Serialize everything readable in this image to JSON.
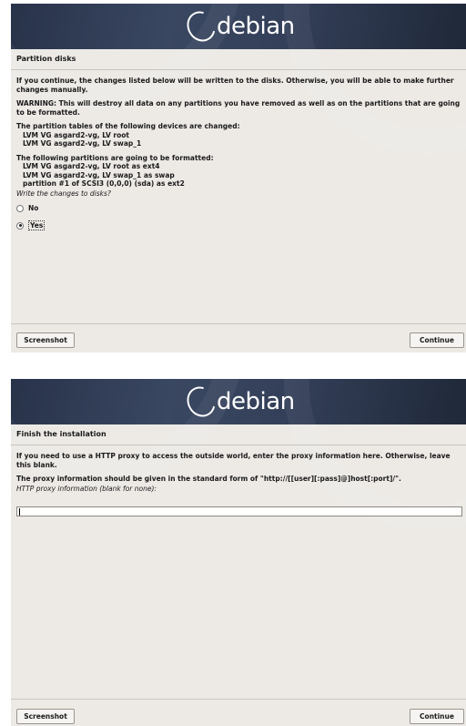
{
  "brand": {
    "logo_text": "debian"
  },
  "screen1": {
    "title": "Partition disks",
    "paragraphs": [
      "If you continue, the changes listed below will be written to the disks. Otherwise, you will be able to make further changes manually.",
      "WARNING: This will destroy all data on any partitions you have removed as well as on the partitions that are going to be formatted."
    ],
    "partition_tables_heading": "The partition tables of the following devices are changed:",
    "partition_tables": [
      "LVM VG asgard2-vg, LV root",
      "LVM VG asgard2-vg, LV swap_1"
    ],
    "formatted_heading": "The following partitions are going to be formatted:",
    "formatted": [
      "LVM VG asgard2-vg, LV root as ext4",
      "LVM VG asgard2-vg, LV swap_1 as swap",
      "partition #1 of SCSI3 (0,0,0) (sda) as ext2"
    ],
    "question": "Write the changes to disks?",
    "options": [
      {
        "label": "No",
        "selected": false
      },
      {
        "label": "Yes",
        "selected": true
      }
    ],
    "screenshot_label": "Screenshot",
    "continue_label": "Continue"
  },
  "screen2": {
    "title": "Finish the installation",
    "paragraphs": [
      "If you need to use a HTTP proxy to access the outside world, enter the proxy information here. Otherwise, leave this blank.",
      "The proxy information should be given in the standard form of \"http://[[user][:pass]@]host[:port]/\"."
    ],
    "input_label": "HTTP proxy information (blank for none):",
    "input_value": "",
    "screenshot_label": "Screenshot",
    "continue_label": "Continue"
  }
}
